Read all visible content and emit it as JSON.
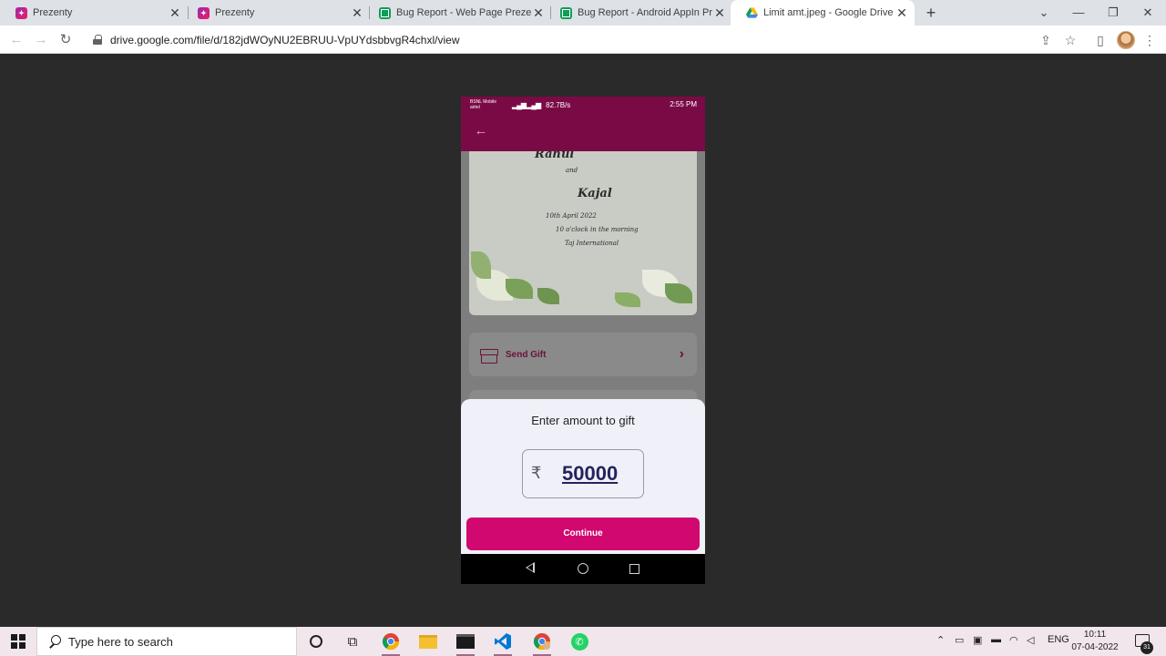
{
  "browser": {
    "tabs": [
      {
        "title": "Prezenty",
        "favicon": "prezenty-icon",
        "active": false
      },
      {
        "title": "Prezenty",
        "favicon": "prezenty-icon",
        "active": false
      },
      {
        "title": "Bug Report - Web Page Prezenty",
        "favicon": "sheets-icon",
        "active": false
      },
      {
        "title": "Bug Report - Android AppIn Prezenty",
        "favicon": "sheets-icon",
        "active": false
      },
      {
        "title": "Limit amt.jpeg - Google Drive",
        "favicon": "drive-icon",
        "active": true
      }
    ],
    "url": "drive.google.com/file/d/182jdWOyNU2EBRUU-VpUYdsbbvgR4chxl/view"
  },
  "phone": {
    "status": {
      "carrier_line1": "BSNL Mobile",
      "carrier_line2": "airtel",
      "speed": "82.7B/s",
      "time": "2:55 PM"
    },
    "invitation": {
      "name1": "Rahul",
      "and": "and",
      "name2": "Kajal",
      "date": "10th April 2022",
      "time": "10 o'clock in the morning",
      "venue": "Taj International"
    },
    "send_gift_label": "Send Gift",
    "sheet": {
      "title": "Enter amount to gift",
      "currency": "₹",
      "amount": "50000",
      "continue_label": "Continue"
    }
  },
  "taskbar": {
    "search_placeholder": "Type here to search",
    "language": "ENG",
    "time": "10:11",
    "date": "07-04-2022",
    "notification_count": "31"
  }
}
